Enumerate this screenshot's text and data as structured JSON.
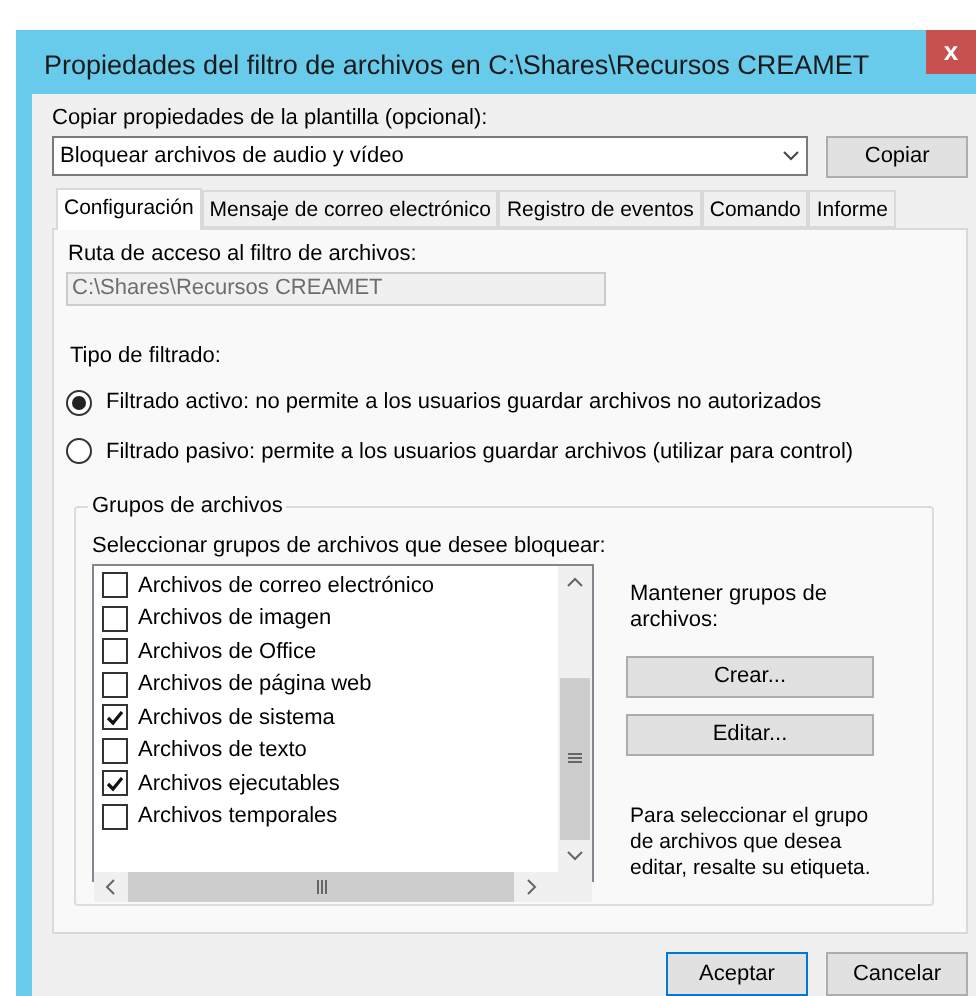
{
  "window": {
    "title": "Propiedades del filtro de archivos en C:\\Shares\\Recursos CREAMET",
    "close": "x"
  },
  "template": {
    "label": "Copiar propiedades de la plantilla (opcional):",
    "value": "Bloquear archivos de audio y vídeo",
    "button": "Copiar"
  },
  "tabs": [
    {
      "label": "Configuración",
      "selected": true
    },
    {
      "label": "Mensaje de correo electrónico",
      "selected": false
    },
    {
      "label": "Registro de eventos",
      "selected": false
    },
    {
      "label": "Comando",
      "selected": false
    },
    {
      "label": "Informe",
      "selected": false
    }
  ],
  "path": {
    "label": "Ruta de acceso al filtro de archivos:",
    "value": "C:\\Shares\\Recursos CREAMET",
    "disabled": true
  },
  "filter_type": {
    "label": "Tipo de filtrado:",
    "options": [
      {
        "label": "Filtrado activo: no permite a los usuarios guardar archivos no autorizados",
        "selected": true
      },
      {
        "label": "Filtrado pasivo: permite a los usuarios guardar archivos (utilizar para control)",
        "selected": false
      }
    ]
  },
  "file_groups": {
    "title": "Grupos de archivos",
    "label": "Seleccionar grupos de archivos que desee bloquear:",
    "items": [
      {
        "label": "Archivos de correo electrónico",
        "checked": false
      },
      {
        "label": "Archivos de imagen",
        "checked": false
      },
      {
        "label": "Archivos de Office",
        "checked": false
      },
      {
        "label": "Archivos de página web",
        "checked": false
      },
      {
        "label": "Archivos de sistema",
        "checked": true
      },
      {
        "label": "Archivos de texto",
        "checked": false
      },
      {
        "label": "Archivos ejecutables",
        "checked": true
      },
      {
        "label": "Archivos temporales",
        "checked": false
      }
    ],
    "maintain_label": "Mantener grupos de archivos:",
    "buttons": [
      "Crear...",
      "Editar..."
    ],
    "hint": "Para seleccionar el grupo de archivos que desea editar, resalte su etiqueta."
  },
  "buttons": [
    {
      "label": "Aceptar",
      "default": true
    },
    {
      "label": "Cancelar",
      "default": false
    }
  ]
}
